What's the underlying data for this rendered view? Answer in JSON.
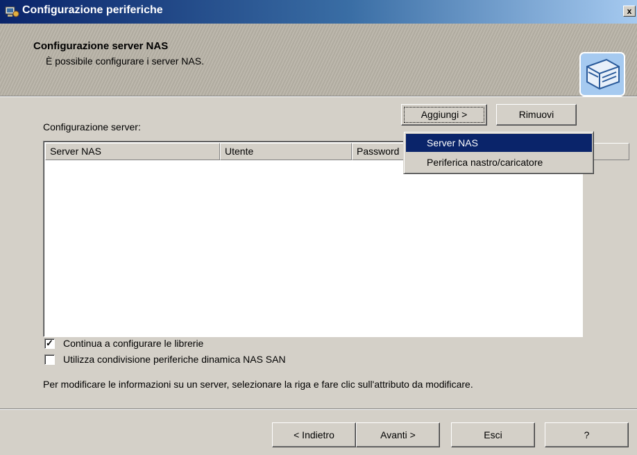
{
  "window": {
    "title": "Configurazione periferiche",
    "close_label": "x"
  },
  "header": {
    "title": "Configurazione server NAS",
    "subtitle": "È possibile configurare i server NAS."
  },
  "main": {
    "config_label": "Configurazione server:",
    "add_button": "Aggiungi >",
    "remove_button": "Rimuovi",
    "columns": [
      "Server NAS",
      "Utente",
      "Password"
    ],
    "dropdown": [
      "Server NAS",
      "Periferica nastro/caricatore"
    ],
    "checkboxes": [
      {
        "label": "Continua a configurare le librerie",
        "checked": true,
        "mark": "✓"
      },
      {
        "label": "Utilizza condivisione periferiche dinamica NAS SAN",
        "checked": false,
        "mark": ""
      }
    ],
    "info": "Per modificare le informazioni su un server, selezionare la riga e fare clic sull'attributo da modificare."
  },
  "footer": {
    "back": "< Indietro",
    "next": "Avanti >",
    "exit": "Esci",
    "help": "?"
  },
  "colors": {
    "title_bar": "#0a246a",
    "dialog_bg": "#d4d0c8",
    "menu_highlight": "#0a246a"
  },
  "icons": {
    "title": "computer-device-icon",
    "header": "storage-device-icon"
  }
}
